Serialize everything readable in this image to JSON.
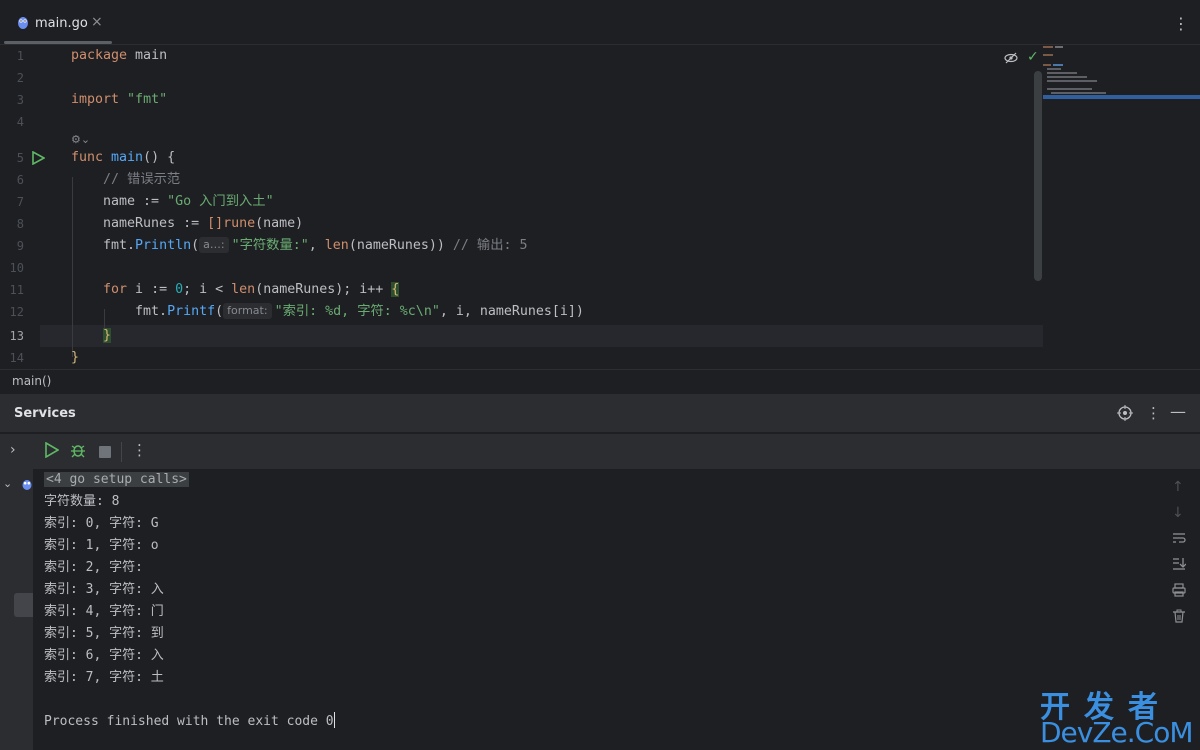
{
  "tab": {
    "label": "main.go",
    "close": "×",
    "more": "⋮"
  },
  "editor": {
    "line_numbers": [
      "1",
      "2",
      "3",
      "4",
      "5",
      "6",
      "7",
      "8",
      "9",
      "10",
      "11",
      "12",
      "13",
      "14"
    ],
    "inlay_symbol": "⚙⌄",
    "hint_a": "a…:",
    "hint_format": "format:",
    "code": {
      "l1_kw": "package",
      "l1_name": " main",
      "l3_kw": "import",
      "l3_str": " \"fmt\"",
      "l5_kw": "func",
      "l5_fn": " main",
      "l5_rest": "() {",
      "l6_cm": "    // 错误示范",
      "l7_a": "    name := ",
      "l7_str": "\"Go 入门到入土\"",
      "l8_a": "    nameRunes := ",
      "l8_br": "[]",
      "l8_kw": "rune",
      "l8_rest": "(name)",
      "l9_a": "    fmt.",
      "l9_fn": "Println",
      "l9_p": "(",
      "l9_str": "\"字符数量:\"",
      "l9_b": ", ",
      "l9_len": "len",
      "l9_c": "(nameRunes)) ",
      "l9_cm": "// 输出: 5",
      "l11_kw": "    for",
      "l11_a": " i := ",
      "l11_num": "0",
      "l11_b": "; i < ",
      "l11_len": "len",
      "l11_c": "(nameRunes); i++ ",
      "l11_brace": "{",
      "l12_a": "        fmt.",
      "l12_fn": "Printf",
      "l12_p": "(",
      "l12_str": "\"索引: %d, 字符: %c\\n\"",
      "l12_rest": ", i, nameRunes[i])",
      "l13_brace": "}",
      "l14_brace": "}"
    }
  },
  "breadcrumb": "main()",
  "services": {
    "title": "Services",
    "console": {
      "setup": "<4 go setup calls>",
      "lines": [
        "字符数量: 8",
        "索引: 0, 字符: G",
        "索引: 1, 字符: o",
        "索引: 2, 字符:  ",
        "索引: 3, 字符: 入",
        "索引: 4, 字符: 门",
        "索引: 5, 字符: 到",
        "索引: 6, 字符: 入",
        "索引: 7, 字符: 土"
      ],
      "finish": "Process finished with the exit code 0"
    }
  },
  "watermark": {
    "top": "开发者",
    "bottom": "DevZe.CoM"
  },
  "colors": {
    "background": "#1e1f22",
    "panel": "#2b2d30",
    "run": "#5fb865",
    "keyword": "#cf8e6d",
    "string": "#6aab73",
    "function": "#56a8f5"
  }
}
